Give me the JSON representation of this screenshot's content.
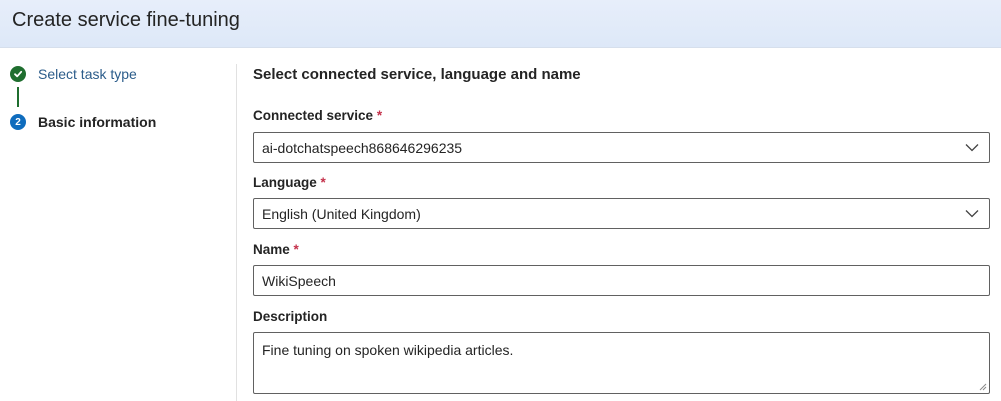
{
  "header": {
    "title": "Create service fine-tuning"
  },
  "stepper": {
    "steps": [
      {
        "label": "Select task type",
        "state": "completed",
        "icon": "checkmark-icon"
      },
      {
        "label": "Basic information",
        "state": "current",
        "number": "2"
      }
    ]
  },
  "form": {
    "section_title": "Select connected service, language and name",
    "required_marker": "*",
    "connected_service": {
      "label": "Connected service",
      "value": "ai-dotchatspeech868646296235"
    },
    "language": {
      "label": "Language",
      "value": "English (United Kingdom)"
    },
    "name": {
      "label": "Name",
      "value": "WikiSpeech"
    },
    "description": {
      "label": "Description",
      "value": "Fine tuning on spoken wikipedia articles."
    }
  },
  "colors": {
    "completed": "#1f6e2f",
    "current": "#0f6cbd",
    "required": "#c4314b"
  }
}
